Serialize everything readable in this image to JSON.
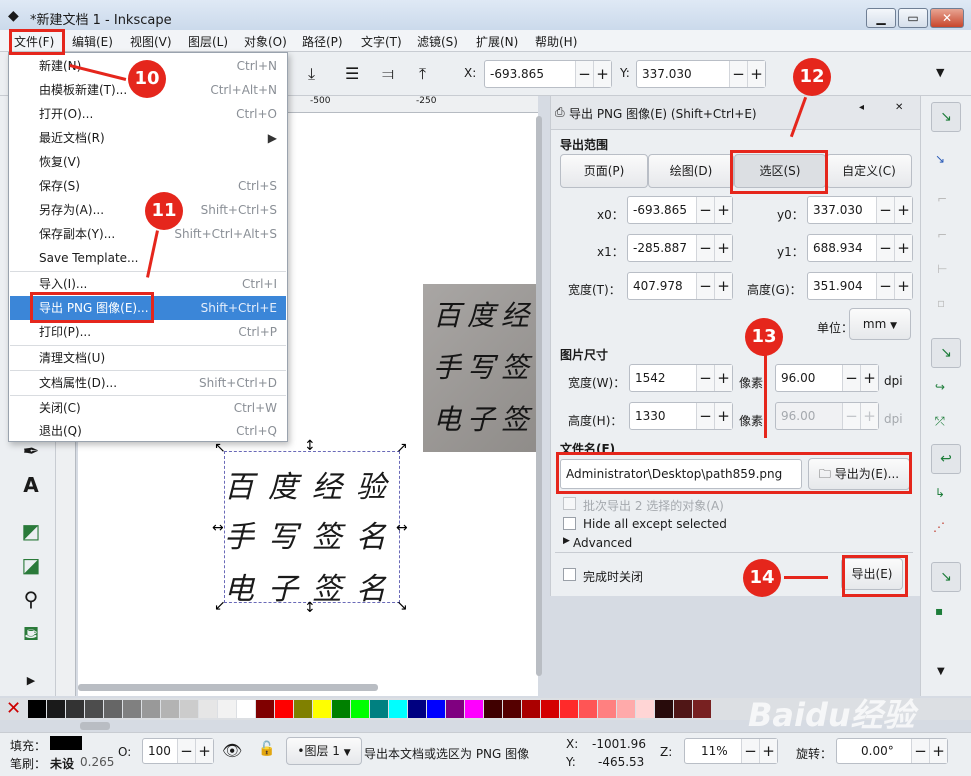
{
  "window": {
    "title": "*新建文档 1 - Inkscape"
  },
  "menubar": [
    "文件(F)",
    "编辑(E)",
    "视图(V)",
    "图层(L)",
    "对象(O)",
    "路径(P)",
    "文字(T)",
    "滤镜(S)",
    "扩展(N)",
    "帮助(H)"
  ],
  "toolbar": {
    "x_label": "X:",
    "x_value": "-693.865",
    "y_label": "Y:",
    "y_value": "337.030"
  },
  "ruler": {
    "tick1": "-500",
    "tick2": "-250"
  },
  "file_menu": {
    "items": [
      {
        "label": "新建(N)",
        "shortcut": "Ctrl+N"
      },
      {
        "label": "由模板新建(T)...",
        "shortcut": "Ctrl+Alt+N"
      },
      {
        "label": "打开(O)...",
        "shortcut": "Ctrl+O"
      },
      {
        "label": "最近文档(R)",
        "shortcut": "▶"
      },
      {
        "label": "恢复(V)",
        "shortcut": ""
      },
      {
        "label": "保存(S)",
        "shortcut": "Ctrl+S"
      },
      {
        "label": "另存为(A)...",
        "shortcut": "Shift+Ctrl+S"
      },
      {
        "label": "保存副本(Y)...",
        "shortcut": "Shift+Ctrl+Alt+S"
      },
      {
        "label": "Save Template...",
        "shortcut": ""
      },
      {
        "label": "导入(I)...",
        "shortcut": "Ctrl+I"
      },
      {
        "label": "导出 PNG 图像(E)...",
        "shortcut": "Shift+Ctrl+E"
      },
      {
        "label": "打印(P)...",
        "shortcut": "Ctrl+P"
      },
      {
        "label": "清理文档(U)",
        "shortcut": ""
      },
      {
        "label": "文档属性(D)...",
        "shortcut": "Shift+Ctrl+D"
      },
      {
        "label": "关闭(C)",
        "shortcut": "Ctrl+W"
      },
      {
        "label": "退出(Q)",
        "shortcut": "Ctrl+Q"
      }
    ]
  },
  "export_dialog": {
    "header": "导出 PNG 图像(E) (Shift+Ctrl+E)",
    "range_title": "导出范围",
    "tabs": [
      "页面(P)",
      "绘图(D)",
      "选区(S)",
      "自定义(C)"
    ],
    "x0_label": "x0：",
    "x0": "-693.865",
    "y0_label": "y0：",
    "y0": "337.030",
    "x1_label": "x1：",
    "x1": "-285.887",
    "y1_label": "y1：",
    "y1": "688.934",
    "width_label": "宽度(T)：",
    "width": "407.978",
    "height_label": "高度(G)：",
    "height": "351.904",
    "unit_label": "单位：",
    "unit": "mm",
    "size_title": "图片尺寸",
    "px_width_label": "宽度(W)：",
    "px_width": "1542",
    "px_height_label": "高度(H)：",
    "px_height": "1330",
    "px_unit": "像素",
    "dpi1": "96.00",
    "dpi2": "96.00",
    "dpi_unit": "dpi",
    "filename_title": "文件名(F)",
    "filename": "Administrator\\Desktop\\path859.png",
    "export_as": "导出为(E)...",
    "batch": "批次导出 2 选择的对象(A)",
    "hide_all": "Hide all except selected",
    "advanced": "Advanced",
    "close_when_done": "完成时关闭",
    "export_button": "导出(E)"
  },
  "canvas_text": {
    "line1": "百度经验",
    "line2": "手写签名",
    "line3": "电子签名"
  },
  "photo_text": {
    "line1": "百度经",
    "line2": "手写签",
    "line3": "电子签"
  },
  "palette": [
    "#000000",
    "#1a1a1a",
    "#333333",
    "#4d4d4d",
    "#666666",
    "#808080",
    "#999999",
    "#b3b3b3",
    "#cccccc",
    "#e6e6e6",
    "#f2f2f2",
    "#ffffff",
    "#800000",
    "#ff0000",
    "#808000",
    "#ffff00",
    "#008000",
    "#00ff00",
    "#008080",
    "#00ffff",
    "#000080",
    "#0000ff",
    "#800080",
    "#ff00ff",
    "#400000",
    "#550000",
    "#aa0000",
    "#d40000",
    "#ff2a2a",
    "#ff5555",
    "#ff8080",
    "#ffaaaa",
    "#ffd5d5",
    "#280b0b",
    "#501616",
    "#782121"
  ],
  "status": {
    "fill_label": "填充：",
    "stroke_label": "笔刷：",
    "stroke_value": "未设",
    "stroke_width": "0.265",
    "opacity_label": "O:",
    "opacity": "100",
    "layer": "•图层 1",
    "message": "导出本文档或选区为 PNG 图像",
    "x_label": "X:",
    "x": "-1001.96",
    "y_label": "Y:",
    "y": "-465.53",
    "zoom_label": "Z:",
    "zoom": "11%",
    "rotate_label": "旋转：",
    "rotate": "0.00°"
  },
  "annotations": [
    "10",
    "11",
    "12",
    "13",
    "14"
  ],
  "watermark": "Baidu经验"
}
